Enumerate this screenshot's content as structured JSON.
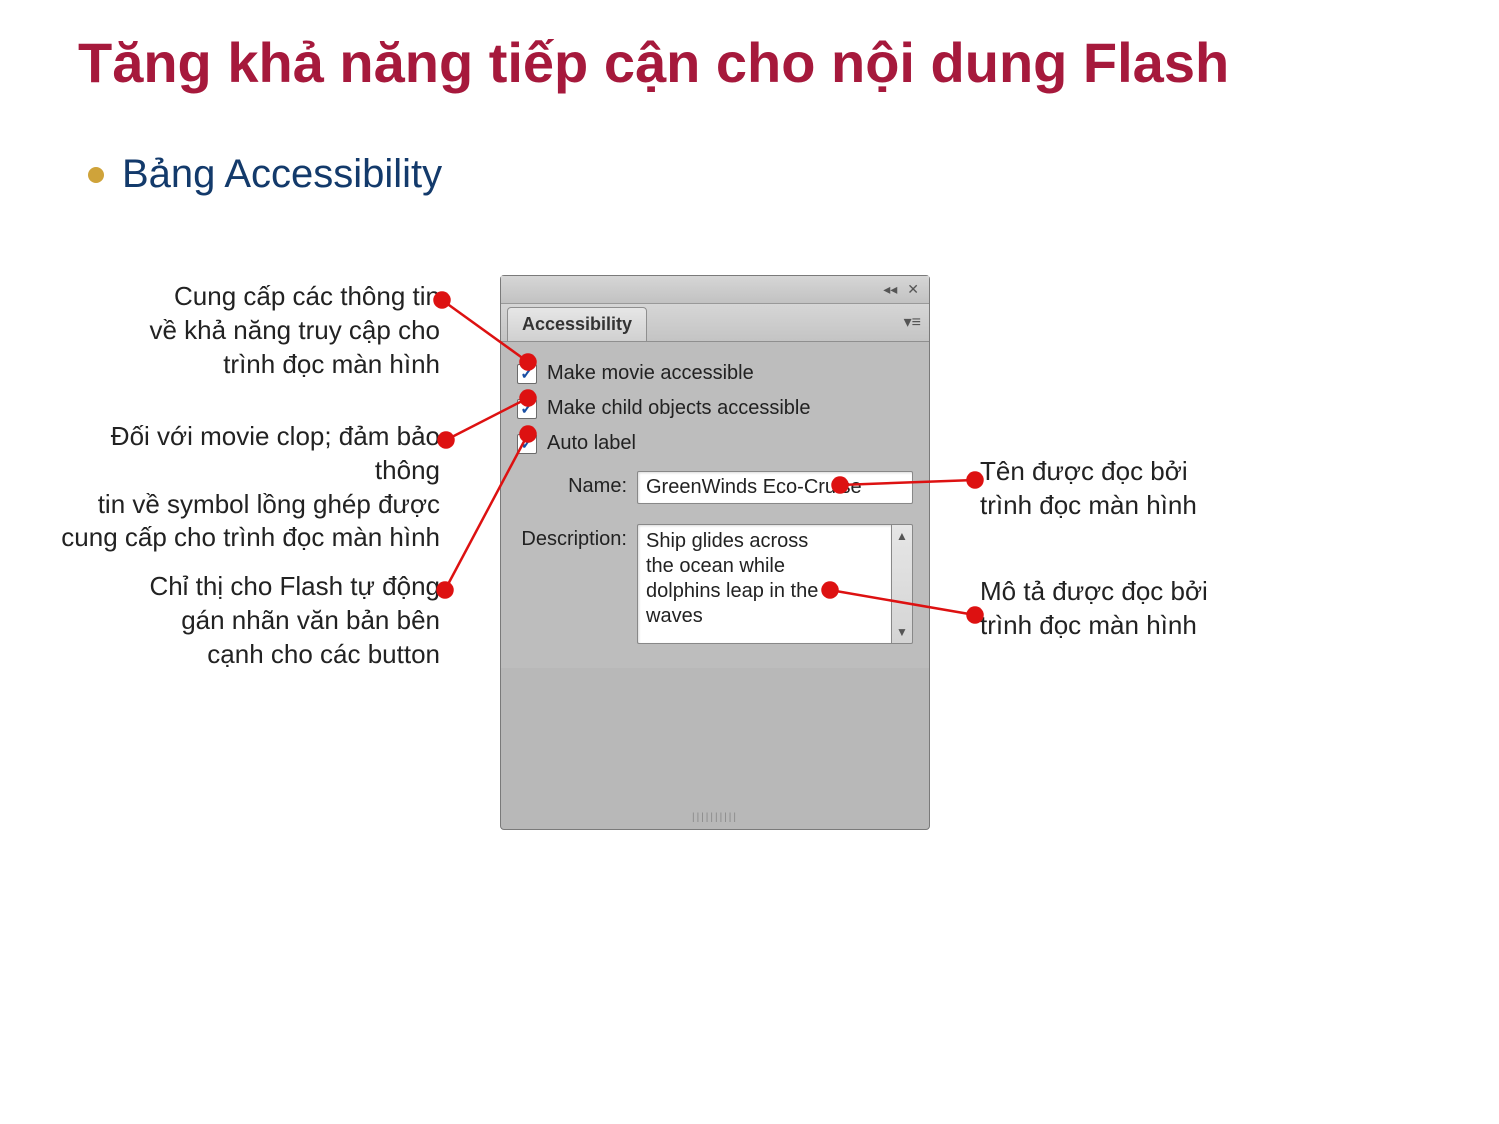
{
  "title": "Tăng khả năng tiếp cận cho nội dung Flash",
  "bullet": "Bảng Accessibility",
  "callouts": {
    "left1": "Cung cấp các thông tin\nvề khả năng truy cập cho\ntrình đọc màn hình",
    "left2": "Đối với movie clop; đảm bảo thông\ntin về symbol lồng ghép được\ncung cấp cho trình đọc màn hình",
    "left3": "Chỉ thị cho Flash tự động\ngán nhãn văn bản bên\ncạnh cho các button",
    "right1": "Tên được đọc bởi\ntrình đọc màn hình",
    "right2": "Mô tả được đọc bởi\ntrình đọc màn hình"
  },
  "panel": {
    "tab": "Accessibility",
    "check1": "Make movie accessible",
    "check2": "Make child objects accessible",
    "check3": "Auto label",
    "name_label": "Name:",
    "name_value": "GreenWinds Eco-Cruise",
    "desc_label": "Description:",
    "desc_value": "Ship glides across\nthe ocean while\ndolphins leap in the\nwaves"
  }
}
